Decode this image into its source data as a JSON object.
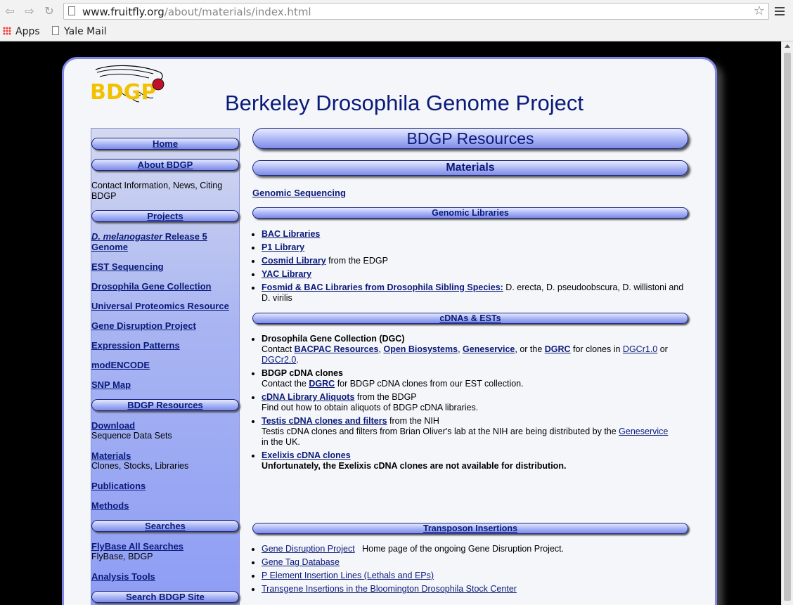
{
  "browser": {
    "url_host": "www.fruitfly.org",
    "url_path": "/about/materials/index.html",
    "bookmarks": [
      "Apps",
      "Yale Mail"
    ]
  },
  "header": {
    "title": "Berkeley Drosophila Genome Project",
    "logo_text": "BDGP"
  },
  "sidebar": {
    "home": "Home",
    "about": "About BDGP",
    "about_desc_1": "Contact Information, News, Citing",
    "about_desc_2": "BDGP",
    "projects": "Projects",
    "proj_mel_italic": "D. melanogaster",
    "proj_mel_rest": " Release 5",
    "proj_mel_line2": "Genome",
    "est": "EST Sequencing",
    "dgc": "Drosophila Gene Collection",
    "upr": "Universal Proteomics Resource",
    "gdp": "Gene Disruption Project",
    "expr": "Expression Patterns",
    "modencode": "modENCODE",
    "snp": "SNP Map",
    "resources": "BDGP Resources",
    "download": "Download",
    "download_desc": "Sequence Data Sets",
    "materials": "Materials",
    "materials_desc": "Clones, Stocks, Libraries",
    "publications": "Publications",
    "methods": "Methods",
    "searches": "Searches",
    "flybase": "FlyBase All Searches",
    "flybase_desc": "FlyBase, BDGP",
    "analysis": "Analysis Tools",
    "search_site": "Search BDGP Site"
  },
  "main": {
    "resources_title": "BDGP Resources",
    "materials_title": "Materials",
    "genomic_sequencing": "Genomic Sequencing",
    "genomic_libraries": "Genomic Libraries",
    "gl": {
      "bac": "BAC Libraries",
      "p1": "P1 Library",
      "cosmid": "Cosmid Library",
      "cosmid_rest": " from the EDGP",
      "yac": "YAC Library",
      "fosmid": "Fosmid & BAC Libraries from Drosophila Sibling Species:",
      "fosmid_rest": " D. erecta, D. pseudoobscura, D. willistoni and D. virilis"
    },
    "cdnas": "cDNAs & ESTs",
    "cd": {
      "dgc_title": "Drosophila Gene Collection (DGC)",
      "dgc_contact": "Contact ",
      "bacpac": "BACPAC Resources",
      "comma1": ", ",
      "open": "Open Biosystems",
      "comma2": ", ",
      "geneservice": "Geneservice",
      "or_the": ", or the ",
      "dgrc": "DGRC",
      "for_clones": " for clones in ",
      "dgcr1": "DGCr1.0",
      "or": " or",
      "dgcr2": "DGCr2.0",
      "period": ".",
      "bdgp_title": "BDGP cDNA clones",
      "contact_the": "Contact the ",
      "dgrc2": "DGRC",
      "bdgp_rest": " for BDGP cDNA clones from our EST collection.",
      "aliquots": "cDNA Library Aliquots",
      "from_bdgp": " from the BDGP",
      "aliquots_desc": "Find out how to obtain aliquots of BDGP cDNA libraries.",
      "testis": "Testis cDNA clones and filters",
      "from_nih": " from the NIH",
      "testis_desc": "Testis cDNA clones and filters from Brian Oliver's lab at the NIH are being distributed by the ",
      "geneservice2": "Geneservice",
      "in_uk": "in the UK.",
      "exelixis": "Exelixis cDNA clones",
      "exelixis_desc": "Unfortunately, the Exelixis cDNA clones are not available for distribution."
    },
    "transposon": "Transposon Insertions",
    "tr": {
      "gdp": "Gene Disruption Project",
      "gdp_rest": "   Home page of the ongoing Gene Disruption Project.",
      "gtd": "Gene Tag Database",
      "pel": "P Element Insertion Lines (Lethals and EPs)",
      "tg": "Transgene Insertions in the Bloomington Drosophila Stock Center"
    }
  }
}
